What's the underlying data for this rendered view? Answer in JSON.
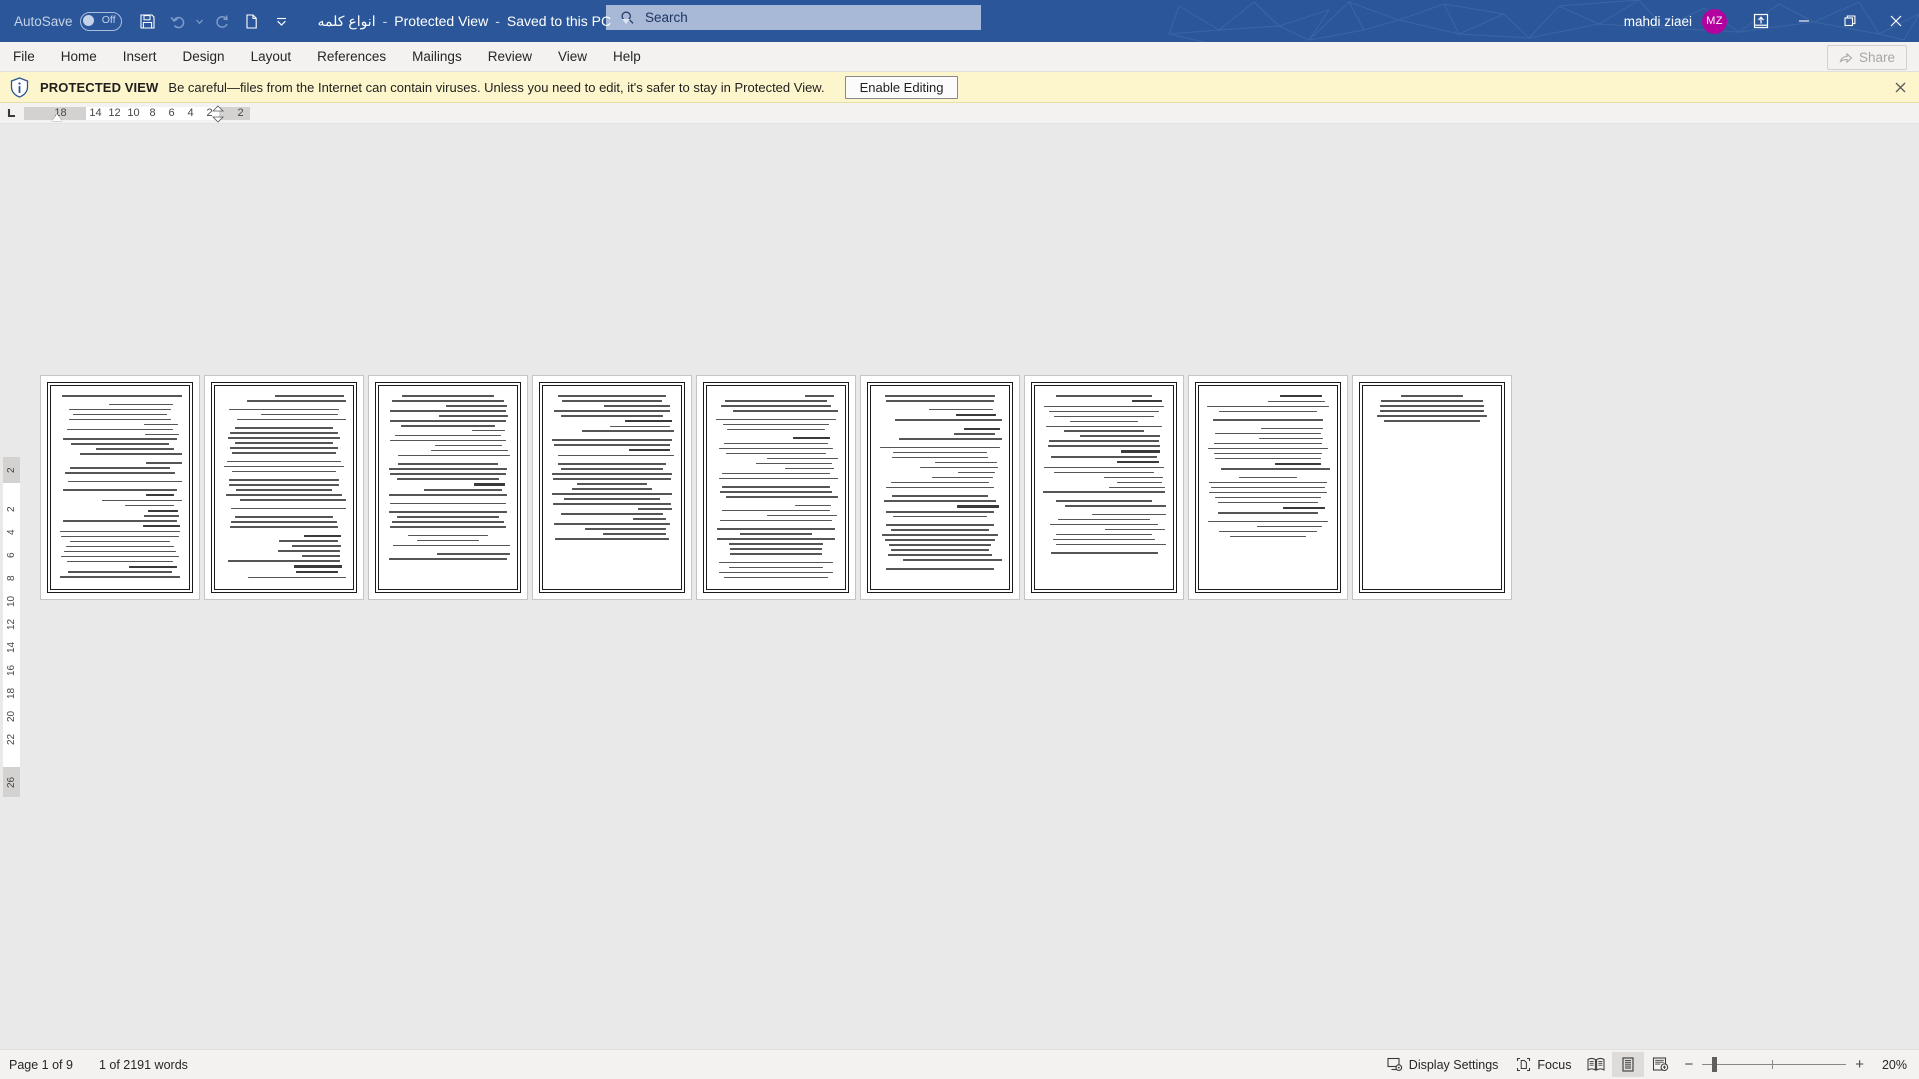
{
  "titlebar": {
    "autosave_label": "AutoSave",
    "autosave_state": "Off",
    "document_title": "انواع کلمه",
    "separator": "-",
    "protected_view": "Protected View",
    "save_location": "Saved to this PC",
    "username": "mahdi ziaei",
    "avatar_initials": "MZ",
    "accent_color": "#2b579a",
    "avatar_color": "#b4009e",
    "quick_access": [
      {
        "name": "save-icon",
        "tooltip": "Save"
      },
      {
        "name": "undo-icon",
        "tooltip": "Undo"
      },
      {
        "name": "undo-dropdown-icon",
        "tooltip": "Undo options"
      },
      {
        "name": "redo-icon",
        "tooltip": "Redo"
      },
      {
        "name": "new-document-icon",
        "tooltip": "New"
      },
      {
        "name": "customize-quick-access-icon",
        "tooltip": "Customize Quick Access Toolbar"
      }
    ],
    "window_controls": [
      {
        "name": "ribbon-display-options-icon"
      },
      {
        "name": "minimize-icon"
      },
      {
        "name": "restore-icon"
      },
      {
        "name": "close-icon"
      }
    ]
  },
  "search": {
    "placeholder": "Search",
    "icon": "search-icon"
  },
  "ribbon": {
    "tabs": [
      {
        "label": "File"
      },
      {
        "label": "Home"
      },
      {
        "label": "Insert"
      },
      {
        "label": "Design"
      },
      {
        "label": "Layout"
      },
      {
        "label": "References"
      },
      {
        "label": "Mailings"
      },
      {
        "label": "Review"
      },
      {
        "label": "View"
      },
      {
        "label": "Help"
      }
    ],
    "share_label": "Share",
    "share_disabled": true
  },
  "protected_view": {
    "icon": "info-shield-icon",
    "title": "PROTECTED VIEW",
    "message": "Be careful—files from the Internet can contain viruses. Unless you need to edit, it's safer to stay in Protected View.",
    "button_label": "Enable Editing",
    "close_icon": "close-icon",
    "background_color": "#fdf6cd"
  },
  "ruler": {
    "tab_stop_selector": "left-tab-icon",
    "horizontal_ticks": [
      "18",
      "14",
      "12",
      "10",
      "8",
      "6",
      "4",
      "2",
      "2"
    ],
    "vertical_ticks": [
      "2",
      "2",
      "4",
      "6",
      "8",
      "10",
      "12",
      "14",
      "16",
      "18",
      "20",
      "22",
      "26"
    ]
  },
  "document": {
    "page_count": 9,
    "pages": [
      {
        "number": 1,
        "line_count": 34
      },
      {
        "number": 2,
        "line_count": 32
      },
      {
        "number": 3,
        "line_count": 30
      },
      {
        "number": 4,
        "line_count": 28
      },
      {
        "number": 5,
        "line_count": 33
      },
      {
        "number": 6,
        "line_count": 31
      },
      {
        "number": 7,
        "line_count": 30
      },
      {
        "number": 8,
        "line_count": 26
      },
      {
        "number": 9,
        "line_count": 6
      }
    ]
  },
  "statusbar": {
    "page_indicator": "Page 1 of 9",
    "word_count": "1 of 2191 words",
    "display_settings_label": "Display Settings",
    "focus_label": "Focus",
    "view_modes": [
      {
        "name": "read-mode-icon",
        "active": false
      },
      {
        "name": "print-layout-icon",
        "active": true
      },
      {
        "name": "web-layout-icon",
        "active": false
      }
    ],
    "zoom_out_label": "−",
    "zoom_in_label": "+",
    "zoom_level": "20%"
  }
}
